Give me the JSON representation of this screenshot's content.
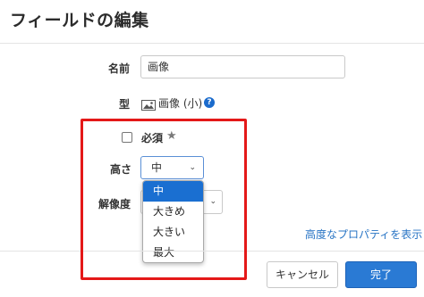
{
  "dialog": {
    "title": "フィールドの編集"
  },
  "form": {
    "name_label": "名前",
    "name_value": "画像",
    "type_label": "型",
    "type_value": "画像 (小)",
    "required_label": "必須",
    "height_label": "高さ",
    "height_selected": "中",
    "resolution_label": "解像度"
  },
  "dropdown": {
    "options": [
      "中",
      "大きめ",
      "大きい",
      "最大"
    ],
    "selected_index": 0
  },
  "links": {
    "advanced": "高度なプロパティを表示"
  },
  "footer": {
    "cancel_label": "キャンセル",
    "done_label": "完了"
  },
  "colors": {
    "accent": "#2a7ad4",
    "selected_option": "#1a6fd1",
    "highlight_frame": "#e41818",
    "link": "#2673c4"
  },
  "icons": [
    "image-icon",
    "help-icon",
    "star-icon",
    "chevron-down-icon"
  ]
}
